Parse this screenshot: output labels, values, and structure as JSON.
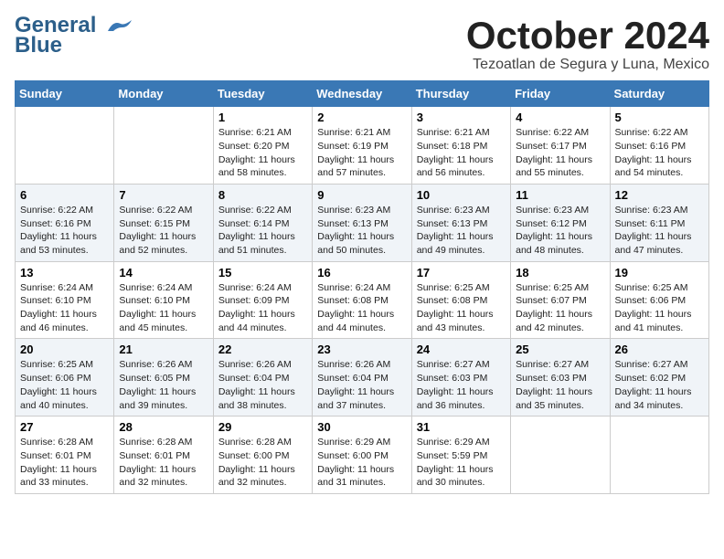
{
  "header": {
    "logo": {
      "line1": "General",
      "line2": "Blue"
    },
    "month": "October 2024",
    "location": "Tezoatlan de Segura y Luna, Mexico"
  },
  "weekdays": [
    "Sunday",
    "Monday",
    "Tuesday",
    "Wednesday",
    "Thursday",
    "Friday",
    "Saturday"
  ],
  "weeks": [
    [
      null,
      null,
      {
        "day": 1,
        "sunrise": "6:21 AM",
        "sunset": "6:20 PM",
        "daylight": "11 hours and 58 minutes."
      },
      {
        "day": 2,
        "sunrise": "6:21 AM",
        "sunset": "6:19 PM",
        "daylight": "11 hours and 57 minutes."
      },
      {
        "day": 3,
        "sunrise": "6:21 AM",
        "sunset": "6:18 PM",
        "daylight": "11 hours and 56 minutes."
      },
      {
        "day": 4,
        "sunrise": "6:22 AM",
        "sunset": "6:17 PM",
        "daylight": "11 hours and 55 minutes."
      },
      {
        "day": 5,
        "sunrise": "6:22 AM",
        "sunset": "6:16 PM",
        "daylight": "11 hours and 54 minutes."
      }
    ],
    [
      {
        "day": 6,
        "sunrise": "6:22 AM",
        "sunset": "6:16 PM",
        "daylight": "11 hours and 53 minutes."
      },
      {
        "day": 7,
        "sunrise": "6:22 AM",
        "sunset": "6:15 PM",
        "daylight": "11 hours and 52 minutes."
      },
      {
        "day": 8,
        "sunrise": "6:22 AM",
        "sunset": "6:14 PM",
        "daylight": "11 hours and 51 minutes."
      },
      {
        "day": 9,
        "sunrise": "6:23 AM",
        "sunset": "6:13 PM",
        "daylight": "11 hours and 50 minutes."
      },
      {
        "day": 10,
        "sunrise": "6:23 AM",
        "sunset": "6:13 PM",
        "daylight": "11 hours and 49 minutes."
      },
      {
        "day": 11,
        "sunrise": "6:23 AM",
        "sunset": "6:12 PM",
        "daylight": "11 hours and 48 minutes."
      },
      {
        "day": 12,
        "sunrise": "6:23 AM",
        "sunset": "6:11 PM",
        "daylight": "11 hours and 47 minutes."
      }
    ],
    [
      {
        "day": 13,
        "sunrise": "6:24 AM",
        "sunset": "6:10 PM",
        "daylight": "11 hours and 46 minutes."
      },
      {
        "day": 14,
        "sunrise": "6:24 AM",
        "sunset": "6:10 PM",
        "daylight": "11 hours and 45 minutes."
      },
      {
        "day": 15,
        "sunrise": "6:24 AM",
        "sunset": "6:09 PM",
        "daylight": "11 hours and 44 minutes."
      },
      {
        "day": 16,
        "sunrise": "6:24 AM",
        "sunset": "6:08 PM",
        "daylight": "11 hours and 44 minutes."
      },
      {
        "day": 17,
        "sunrise": "6:25 AM",
        "sunset": "6:08 PM",
        "daylight": "11 hours and 43 minutes."
      },
      {
        "day": 18,
        "sunrise": "6:25 AM",
        "sunset": "6:07 PM",
        "daylight": "11 hours and 42 minutes."
      },
      {
        "day": 19,
        "sunrise": "6:25 AM",
        "sunset": "6:06 PM",
        "daylight": "11 hours and 41 minutes."
      }
    ],
    [
      {
        "day": 20,
        "sunrise": "6:25 AM",
        "sunset": "6:06 PM",
        "daylight": "11 hours and 40 minutes."
      },
      {
        "day": 21,
        "sunrise": "6:26 AM",
        "sunset": "6:05 PM",
        "daylight": "11 hours and 39 minutes."
      },
      {
        "day": 22,
        "sunrise": "6:26 AM",
        "sunset": "6:04 PM",
        "daylight": "11 hours and 38 minutes."
      },
      {
        "day": 23,
        "sunrise": "6:26 AM",
        "sunset": "6:04 PM",
        "daylight": "11 hours and 37 minutes."
      },
      {
        "day": 24,
        "sunrise": "6:27 AM",
        "sunset": "6:03 PM",
        "daylight": "11 hours and 36 minutes."
      },
      {
        "day": 25,
        "sunrise": "6:27 AM",
        "sunset": "6:03 PM",
        "daylight": "11 hours and 35 minutes."
      },
      {
        "day": 26,
        "sunrise": "6:27 AM",
        "sunset": "6:02 PM",
        "daylight": "11 hours and 34 minutes."
      }
    ],
    [
      {
        "day": 27,
        "sunrise": "6:28 AM",
        "sunset": "6:01 PM",
        "daylight": "11 hours and 33 minutes."
      },
      {
        "day": 28,
        "sunrise": "6:28 AM",
        "sunset": "6:01 PM",
        "daylight": "11 hours and 32 minutes."
      },
      {
        "day": 29,
        "sunrise": "6:28 AM",
        "sunset": "6:00 PM",
        "daylight": "11 hours and 32 minutes."
      },
      {
        "day": 30,
        "sunrise": "6:29 AM",
        "sunset": "6:00 PM",
        "daylight": "11 hours and 31 minutes."
      },
      {
        "day": 31,
        "sunrise": "6:29 AM",
        "sunset": "5:59 PM",
        "daylight": "11 hours and 30 minutes."
      },
      null,
      null
    ]
  ]
}
